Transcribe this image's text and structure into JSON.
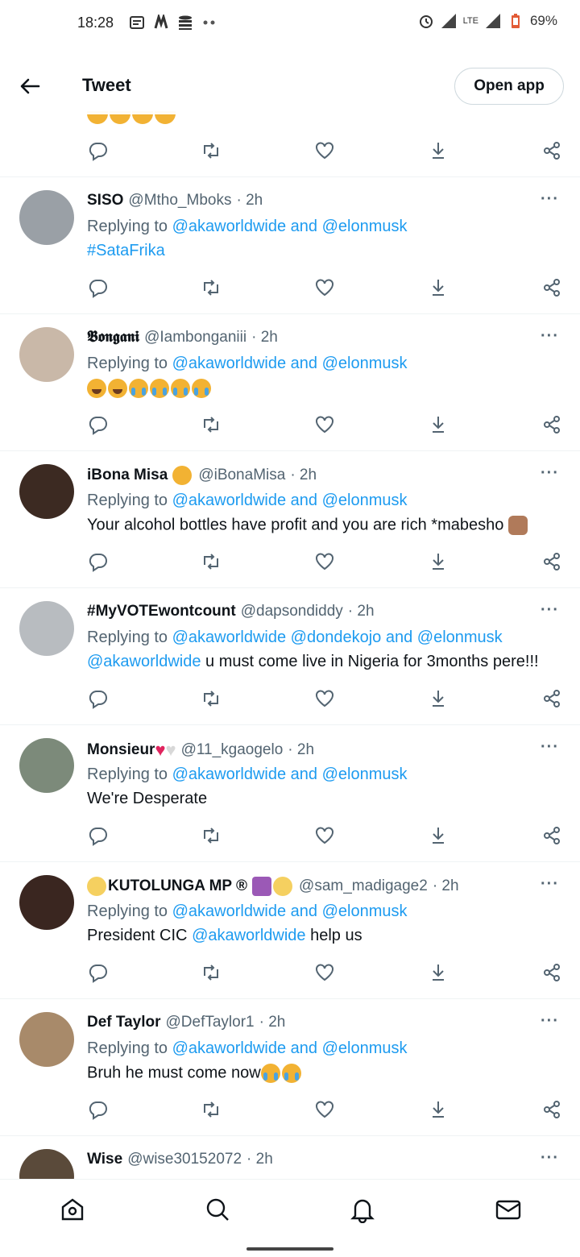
{
  "status": {
    "time": "18:28",
    "network": "LTE",
    "battery": "69%"
  },
  "header": {
    "title": "Tweet",
    "open_app": "Open app"
  },
  "replying_prefix": "Replying to",
  "tweets": [
    {
      "name": "SISO",
      "handle": "@Mtho_Mboks",
      "time": "· 2h",
      "reply_to_1": "@akaworldwide",
      "reply_and": "and",
      "reply_to_2": "@elonmusk",
      "body": "#SataFrika",
      "avatar_color": "#9aa0a6"
    },
    {
      "name": "𝕭𝖔𝖓𝖌𝖆𝖓𝖎",
      "handle": "@Iambonganiii",
      "time": "· 2h",
      "reply_to_1": "@akaworldwide",
      "reply_and": "and",
      "reply_to_2": "@elonmusk",
      "body": "",
      "avatar_color": "#c9b8a8"
    },
    {
      "name": "iBona Misa",
      "handle": "@iBonaMisa",
      "time": "· 2h",
      "reply_to_1": "@akaworldwide",
      "reply_and": "and",
      "reply_to_2": "@elonmusk",
      "body": "Your alcohol bottles have profit and you are rich *mabesho",
      "avatar_color": "#3c2a22"
    },
    {
      "name": "#MyVOTEwontcount",
      "handle": "@dapsondiddy",
      "time": "· 2h",
      "reply_to_1": "@akaworldwide",
      "reply_mid": "@dondekojo",
      "reply_and": "and",
      "reply_to_2": "@elonmusk",
      "body_link": "@akaworldwide",
      "body": "u must come live in Nigeria for 3months pere!!!",
      "avatar_color": "#b8bcc0"
    },
    {
      "name": "Monsieur",
      "handle": "@11_kgaogelo",
      "time": "· 2h",
      "reply_to_1": "@akaworldwide",
      "reply_and": "and",
      "reply_to_2": "@elonmusk",
      "body": "We're Desperate",
      "avatar_color": "#7c8a7a"
    },
    {
      "name": "KUTOLUNGA MP ®",
      "handle": "@sam_madigage2",
      "time": "· 2h",
      "reply_to_1": "@akaworldwide",
      "reply_and": "and",
      "reply_to_2": "@elonmusk",
      "body_pre": "President CIC",
      "body_link": "@akaworldwide",
      "body": "help us",
      "avatar_color": "#3a2620"
    },
    {
      "name": "Def Taylor",
      "handle": "@DefTaylor1",
      "time": "· 2h",
      "reply_to_1": "@akaworldwide",
      "reply_and": "and",
      "reply_to_2": "@elonmusk",
      "body": "Bruh he must come now",
      "avatar_color": "#a88a6a"
    },
    {
      "name": "Wise",
      "handle": "@wise30152072",
      "time": "· 2h",
      "avatar_color": "#5a4a3a"
    }
  ],
  "more_label": "···",
  "colors": {
    "accent": "#1d9bf0",
    "secondary": "#536471",
    "text": "#0f1419"
  }
}
